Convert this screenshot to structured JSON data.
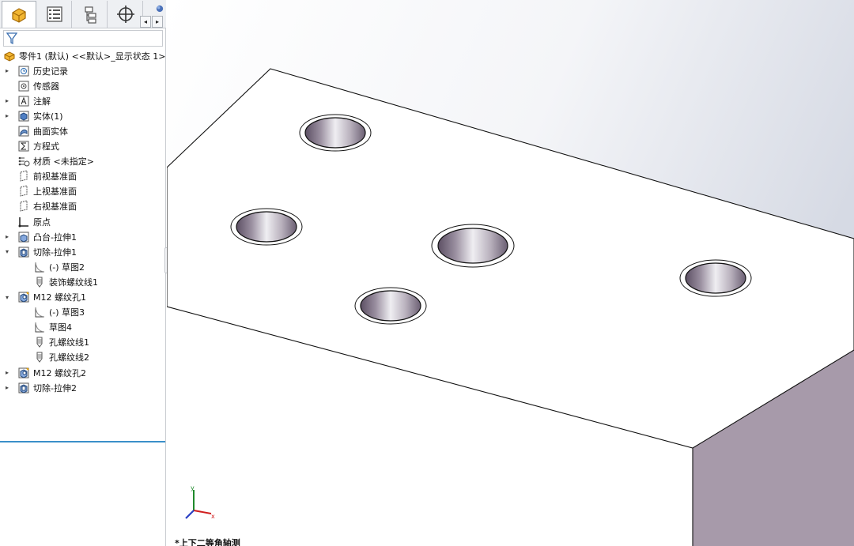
{
  "panel": {
    "tabs": [
      {
        "name": "feature-manager",
        "icon": "part-icon"
      },
      {
        "name": "property-manager",
        "icon": "property-list-icon"
      },
      {
        "name": "configuration-manager",
        "icon": "configuration-icon"
      },
      {
        "name": "dimxpert-manager",
        "icon": "crosshair-icon"
      },
      {
        "name": "display-manager",
        "icon": "sphere-icon"
      }
    ],
    "root_label": "零件1 (默认) <<默认>_显示状态 1>",
    "tree": [
      {
        "label": "历史记录",
        "icon": "history-icon",
        "expandable": true
      },
      {
        "label": "传感器",
        "icon": "sensor-icon",
        "expandable": false
      },
      {
        "label": "注解",
        "icon": "annotation-icon",
        "expandable": true
      },
      {
        "label": "实体(1)",
        "icon": "solid-body-icon",
        "expandable": true
      },
      {
        "label": "曲面实体",
        "icon": "surface-body-icon",
        "expandable": false
      },
      {
        "label": "方程式",
        "icon": "equation-icon",
        "expandable": false
      },
      {
        "label": "材质 <未指定>",
        "icon": "material-icon",
        "expandable": false
      },
      {
        "label": "前视基准面",
        "icon": "plane-icon",
        "expandable": false
      },
      {
        "label": "上视基准面",
        "icon": "plane-icon",
        "expandable": false
      },
      {
        "label": "右视基准面",
        "icon": "plane-icon",
        "expandable": false
      },
      {
        "label": "原点",
        "icon": "origin-icon",
        "expandable": false
      },
      {
        "label": "凸台-拉伸1",
        "icon": "boss-extrude-icon",
        "expandable": true
      },
      {
        "label": "切除-拉伸1",
        "icon": "cut-extrude-icon",
        "expanded": true
      },
      {
        "label": "(-) 草图2",
        "icon": "sketch-icon",
        "child": true
      },
      {
        "label": "装饰螺纹线1",
        "icon": "cosmetic-thread-icon",
        "child": true
      },
      {
        "label": "M12 螺纹孔1",
        "icon": "hole-wizard-icon",
        "expanded": true
      },
      {
        "label": "(-) 草图3",
        "icon": "sketch-icon",
        "child": true
      },
      {
        "label": "草图4",
        "icon": "sketch-icon",
        "child": true
      },
      {
        "label": "孔螺纹线1",
        "icon": "cosmetic-thread-icon",
        "child": true
      },
      {
        "label": "孔螺纹线2",
        "icon": "cosmetic-thread-icon",
        "child": true
      },
      {
        "label": "M12 螺纹孔2",
        "icon": "hole-wizard-icon",
        "expandable": true
      },
      {
        "label": "切除-拉伸2",
        "icon": "cut-extrude-icon",
        "expandable": true
      }
    ]
  },
  "viewport": {
    "view_name": "*上下二等角轴测",
    "triad_axes": {
      "x": "x",
      "y": "y"
    }
  },
  "colors": {
    "model_face_top": "#ffffff",
    "model_face_side": "#a79aaa",
    "background_gradient_end": "#d6dae4",
    "selection_accent": "#3a8fc9"
  }
}
